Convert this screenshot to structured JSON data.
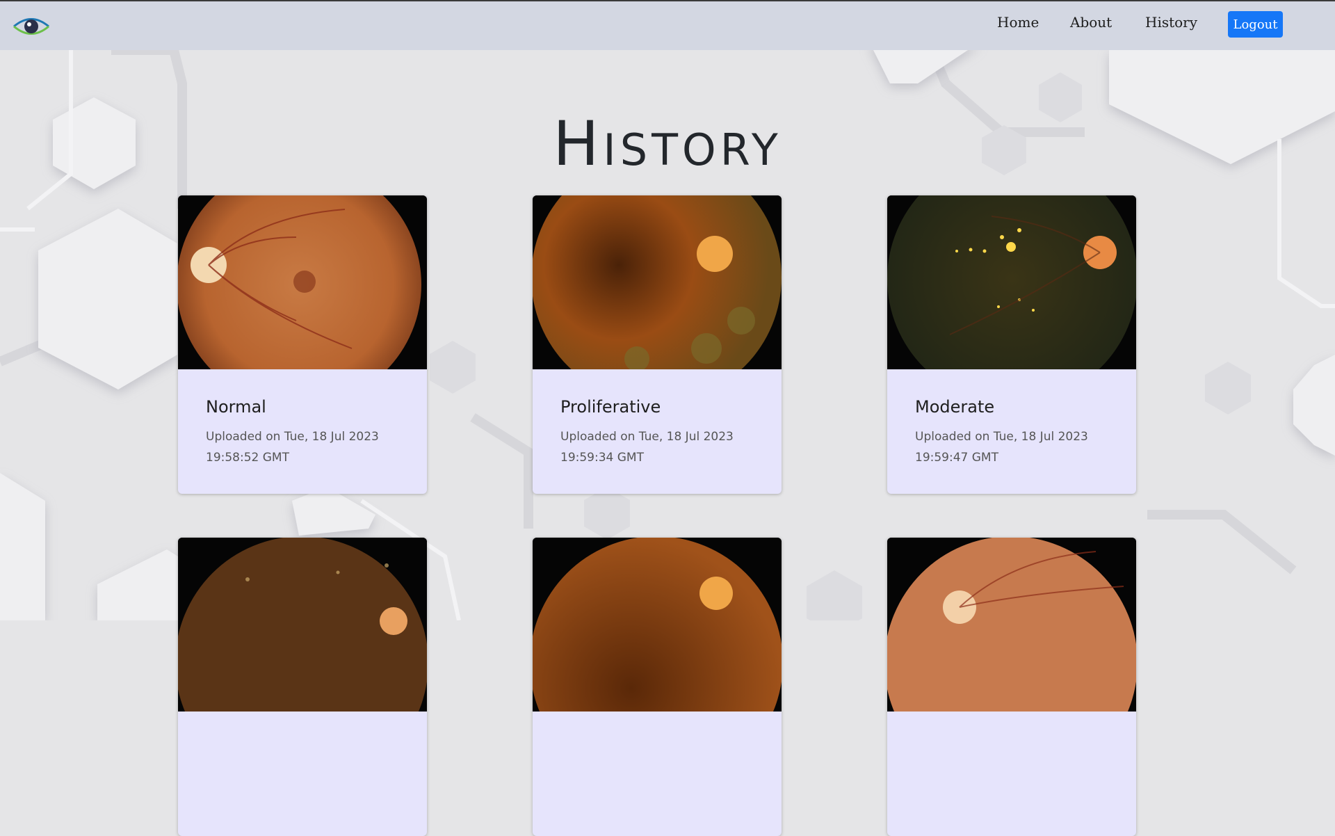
{
  "navbar": {
    "logo_icon": "eye-logo-icon",
    "links": [
      "Home",
      "About",
      "History"
    ],
    "logout_label": "Logout",
    "accent_color": "#1677f7"
  },
  "page": {
    "title": "History"
  },
  "cards": [
    {
      "diagnosis": "Normal",
      "uploaded": "Uploaded on Tue, 18 Jul 2023",
      "time": "19:58:52 GMT"
    },
    {
      "diagnosis": "Proliferative",
      "uploaded": "Uploaded on Tue, 18 Jul 2023",
      "time": "19:59:34 GMT"
    },
    {
      "diagnosis": "Moderate",
      "uploaded": "Uploaded on Tue, 18 Jul 2023",
      "time": "19:59:47 GMT"
    },
    {
      "diagnosis": "",
      "uploaded": "",
      "time": ""
    },
    {
      "diagnosis": "",
      "uploaded": "",
      "time": ""
    },
    {
      "diagnosis": "",
      "uploaded": "",
      "time": ""
    }
  ]
}
